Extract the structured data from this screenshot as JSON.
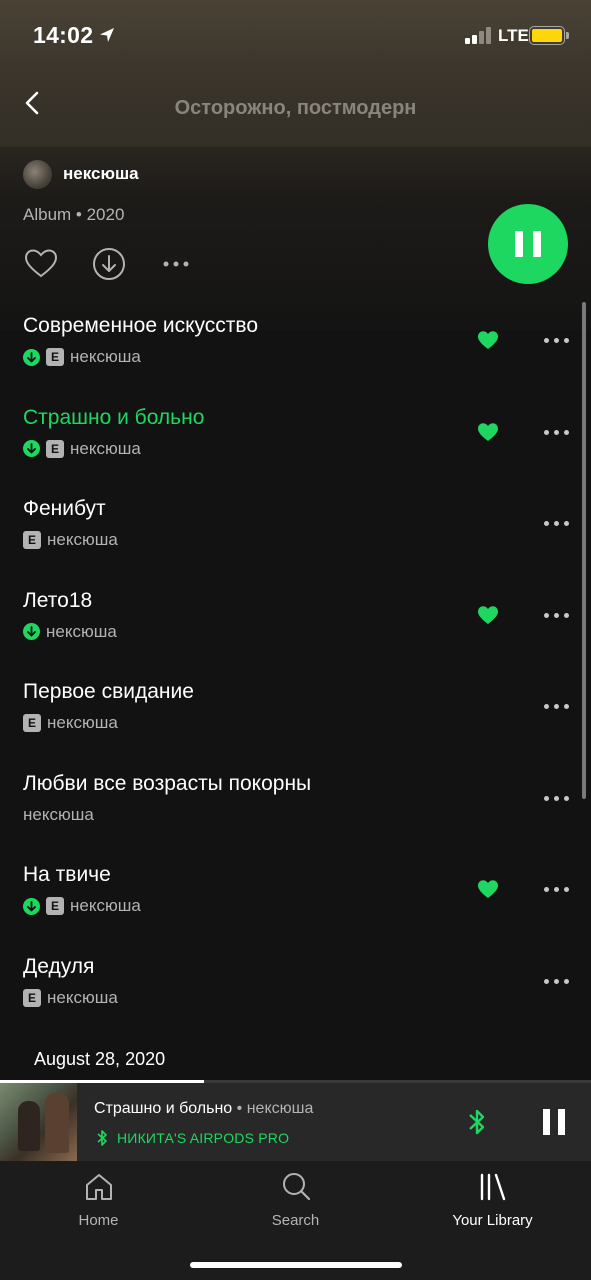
{
  "status_bar": {
    "time": "14:02",
    "network": "LTE",
    "battery_color": "#ffd60a"
  },
  "header": {
    "title": "Осторожно, постмодерн",
    "back_icon": "chevron-left-icon"
  },
  "album": {
    "artist": "нексюша",
    "meta": "Album • 2020",
    "actions": [
      "heart-outline-icon",
      "download-circle-icon",
      "more-icon"
    ],
    "accent_color": "#1ed760"
  },
  "tracks": [
    {
      "title": "Современное искусство",
      "artist": "нексюша",
      "downloaded": true,
      "explicit": true,
      "liked": true,
      "playing": false
    },
    {
      "title": "Страшно и больно",
      "artist": "нексюша",
      "downloaded": true,
      "explicit": true,
      "liked": true,
      "playing": true
    },
    {
      "title": "Фенибут",
      "artist": "нексюша",
      "downloaded": false,
      "explicit": true,
      "liked": false,
      "playing": false
    },
    {
      "title": "Лето18",
      "artist": "нексюша",
      "downloaded": true,
      "explicit": false,
      "liked": true,
      "playing": false
    },
    {
      "title": "Первое свидание",
      "artist": "нексюша",
      "downloaded": false,
      "explicit": true,
      "liked": false,
      "playing": false
    },
    {
      "title": "Любви все возрасты покорны",
      "artist": "нексюша",
      "downloaded": false,
      "explicit": false,
      "liked": false,
      "playing": false
    },
    {
      "title": "На твиче",
      "artist": "нексюша",
      "downloaded": true,
      "explicit": true,
      "liked": true,
      "playing": false
    },
    {
      "title": "Дедуля",
      "artist": "нексюша",
      "downloaded": false,
      "explicit": true,
      "liked": false,
      "playing": false
    }
  ],
  "explicit_label": "E",
  "release_date": "August 28, 2020",
  "now_playing": {
    "title": "Страшно и больно",
    "separator": " • ",
    "artist": "нексюша",
    "device": "НИКИТА'S AIRPODS PRO",
    "progress": 0.345
  },
  "tabs": [
    {
      "label": "Home",
      "icon": "home-icon",
      "active": false
    },
    {
      "label": "Search",
      "icon": "search-icon",
      "active": false
    },
    {
      "label": "Your Library",
      "icon": "library-icon",
      "active": true
    }
  ]
}
